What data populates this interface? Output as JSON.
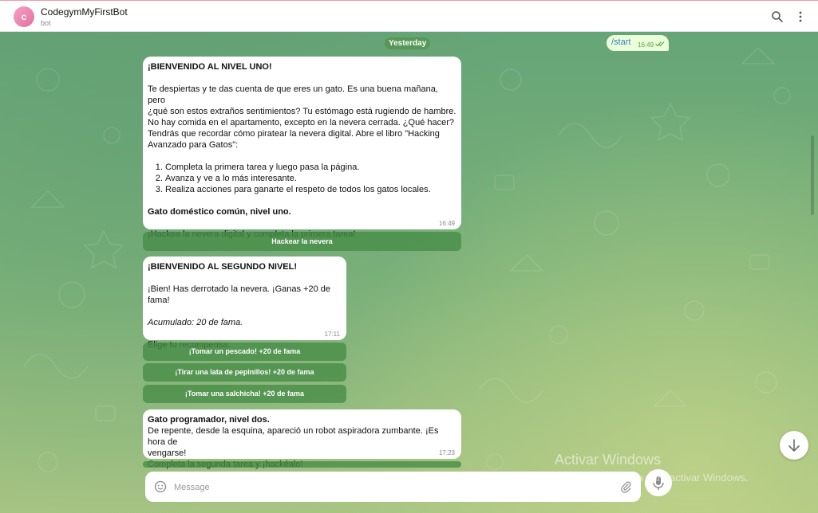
{
  "header": {
    "avatar_letter": "c",
    "title": "CodegymMyFirstBot",
    "subtitle": "bot",
    "icons": [
      "search-icon",
      "more-vertical-icon"
    ]
  },
  "chat": {
    "date_label": "Yesterday",
    "outgoing": {
      "text": "/start",
      "time": "16:49",
      "status_icon": "double-check-icon"
    },
    "message1": {
      "heading": "¡BIENVENIDO AL NIVEL UNO!",
      "line1": "Te despiertas y te das cuenta de que eres un gato. Es una buena mañana, pero",
      "line2": "¿qué son estos extraños sentimientos? Tu estómago está rugiendo de hambre.",
      "line3": "No hay comida en el apartamento, excepto en la nevera cerrada. ¿Qué hacer?",
      "line4": "Tendrás que recordar cómo piratear la nevera digital. Abre el libro \"Hacking",
      "line5": "Avanzado para Gatos\":",
      "list": [
        "Completa la primera tarea y luego pasa la página.",
        "Avanza y ve a lo más interesante.",
        "Realiza acciones para ganarte el respeto de todos los gatos locales."
      ],
      "rank": "Gato doméstico común, nivel uno.",
      "call": "¡Hackea la nevera digital y completa la primera tarea!",
      "time": "16:49",
      "button": "Hackear la nevera"
    },
    "message2": {
      "heading": "¡BIENVENIDO AL SEGUNDO NIVEL!",
      "line1": "¡Bien! Has derrotado la nevera. ¡Ganas +20 de fama!",
      "fame": "Acumulado: 20 de fama.",
      "prompt": "Elige tu recompensa:",
      "time": "17:11",
      "buttons": [
        "¡Tomar un pescado! +20 de fama",
        "¡Tirar una lata de pepinillos! +20 de fama",
        "¡Tomar una salchicha! +20 de fama"
      ]
    },
    "message3": {
      "rank": "Gato programador, nivel dos.",
      "line1": "De repente, desde la esquina, apareció un robot aspiradora zumbante. ¡Es hora de",
      "line2": "vengarse!",
      "line3": "Completa la segunda tarea y ¡hackéalo!",
      "time": "17:23"
    }
  },
  "composer": {
    "placeholder": "Message",
    "icons": [
      "emoji-icon",
      "paperclip-icon",
      "microphone-icon"
    ]
  },
  "scroll_down_icon": "arrow-down-icon",
  "watermark": {
    "line1": "Activar Windows",
    "line2": "Ve a Configuración para activar Windows."
  },
  "colors": {
    "outgoing_bubble": "#eaffd9",
    "keyboard_button": "#5a9a5a",
    "link": "#3b7fc4",
    "avatar": "#e778a8"
  }
}
